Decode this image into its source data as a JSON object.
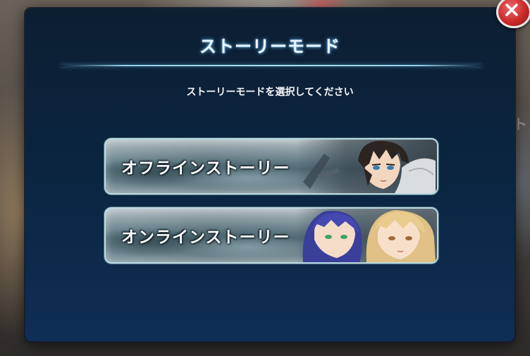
{
  "dialog": {
    "title": "ストーリーモード",
    "instruction": "ストーリーモードを選択してください"
  },
  "buttons": {
    "offline_label": "オフラインストーリー",
    "online_label": "オンラインストーリー"
  },
  "background": {
    "hint_text": "スト"
  },
  "icons": {
    "close": "close-icon"
  },
  "colors": {
    "dialog_bg": "#0b2642",
    "title_glow": "#7fd0ff",
    "close_red": "#c92a2a"
  }
}
